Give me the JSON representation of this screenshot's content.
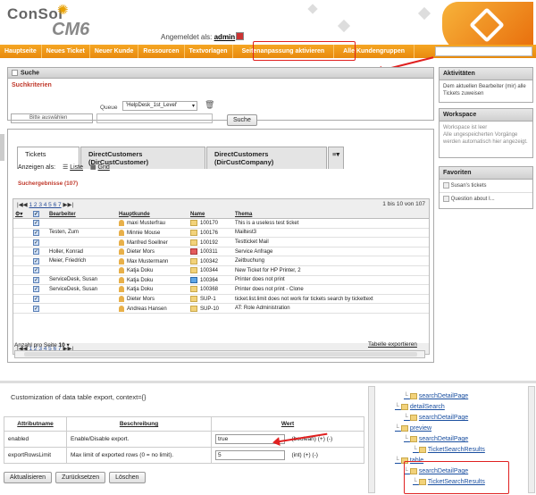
{
  "header": {
    "logo_top": "ConSol",
    "logo_bottom": "CM6",
    "user_prefix": "Angemeldet als:",
    "user_name": "admin"
  },
  "nav": [
    "Hauptseite",
    "Neues Ticket",
    "Neuer Kunde",
    "Ressourcen",
    "Textvorlagen",
    "Seitenanpassung aktivieren",
    "Alle Kundengruppen"
  ],
  "search": {
    "title": "Suche",
    "criteria": "Suchkriterien",
    "queue_label": "Queue",
    "queue_value": "'HelpDesk_1st_Level'",
    "select_placeholder": "Bitte auswählen",
    "search_button": "Suche"
  },
  "tabs": [
    "Tickets",
    "DirectCustomers (DirCustCustomer)",
    "DirectCustomers (DirCustCompany)"
  ],
  "view": {
    "label": "Anzeigen als:",
    "list": "Liste",
    "grid": "Grid"
  },
  "results_title": "Suchergebnisse (107)",
  "pager": {
    "pages": "1 2 3 4 5 6 7",
    "range": "1 bis 10 von 107",
    "per_page_label": "Anzahl pro Seite",
    "per_page": "10",
    "export": "Tabelle exportieren"
  },
  "columns": [
    "Bearbeiter",
    "Hauptkunde",
    "Name",
    "Thema"
  ],
  "rows": [
    {
      "agent": "",
      "customer": "maxi Musterfrau",
      "name": "100170",
      "topic": "This is a useless test ticket",
      "icon": "yellow"
    },
    {
      "agent": "Testen, Zum",
      "customer": "Minnie Mouse",
      "name": "100176",
      "topic": "Mailtest3",
      "icon": "yellow"
    },
    {
      "agent": "",
      "customer": "Manfred Soellner",
      "name": "100192",
      "topic": "Testticket Mail",
      "icon": "yellow"
    },
    {
      "agent": "Holler, Konrad",
      "customer": "Dieter Mors",
      "name": "100311",
      "topic": "Service Anfrage",
      "icon": "red"
    },
    {
      "agent": "Meier, Friedrich",
      "customer": "Max Mustermann",
      "name": "100342",
      "topic": "Zeitbuchung",
      "icon": "yellow"
    },
    {
      "agent": "",
      "customer": "Katja Doku",
      "name": "100344",
      "topic": "New Ticket for HP Printer, 2",
      "icon": "yellow"
    },
    {
      "agent": "ServiceDesk, Susan",
      "customer": "Katja Doku",
      "name": "100364",
      "topic": "Printer does not print",
      "icon": "blue"
    },
    {
      "agent": "ServiceDesk, Susan",
      "customer": "Katja Doku",
      "name": "100368",
      "topic": "Printer does not print - Clone",
      "icon": "yellow"
    },
    {
      "agent": "",
      "customer": "Dieter Mors",
      "name": "SUP-1",
      "topic": "ticket.list.limit does not work for tickets search by tickettext",
      "icon": "yellow"
    },
    {
      "agent": "",
      "customer": "Andreas Hansen",
      "name": "SUP-10",
      "topic": "AT: Role Administration",
      "icon": "yellow"
    }
  ],
  "sidebar": {
    "activities_title": "Aktivitäten",
    "activities_text": "Dem aktuellen Bearbeiter (mir) alle Tickets zuweisen",
    "workspace_title": "Workspace",
    "workspace_text": "Workspace ist leer\nAlle ungespeicherten Vorgänge werden automatisch hier angezeigt.",
    "favorites_title": "Favoriten",
    "favorites": [
      "Susan's tickets",
      "Question about I..."
    ]
  },
  "config": {
    "title": "Customization of data table export, context={}",
    "col_attr": "Attributname",
    "col_desc": "Beschreibung",
    "col_value": "Wert",
    "rows": [
      {
        "attr": "enabled",
        "desc": "Enable/Disable export.",
        "value": "true",
        "type": "(boolean) (+) (-)"
      },
      {
        "attr": "exportRowsLimit",
        "desc": "Max limit of exported rows (0 = no limit).",
        "value": "5",
        "type": "(int) (+) (-)"
      }
    ],
    "buttons": [
      "Aktualisieren",
      "Zurücksetzen",
      "Löschen"
    ]
  },
  "tree": [
    {
      "label": "searchDetailPage",
      "indent": 2
    },
    {
      "label": "detailSearch",
      "indent": 1
    },
    {
      "label": "searchDetailPage",
      "indent": 2
    },
    {
      "label": "preview",
      "indent": 1
    },
    {
      "label": "searchDetailPage",
      "indent": 2
    },
    {
      "label": "TicketSearchResults",
      "indent": 3
    },
    {
      "label": "table",
      "indent": 1
    },
    {
      "label": "searchDetailPage",
      "indent": 2
    },
    {
      "label": "TicketSearchResults",
      "indent": 3
    }
  ]
}
